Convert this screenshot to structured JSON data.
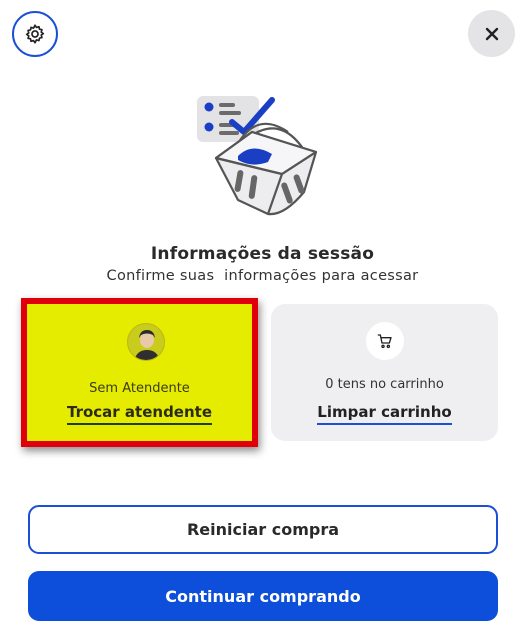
{
  "header": {
    "settings_icon": "gear-icon",
    "close_icon": "close-icon"
  },
  "session": {
    "title": "Informações da sessão",
    "subtitle": "Confirme suas  informações para acessar"
  },
  "attendant_card": {
    "name": "Sem Atendente",
    "action_label": "Trocar atendente",
    "highlight_fill": "#e6ec00",
    "highlight_border": "#e0000a"
  },
  "cart_card": {
    "count_text": "0 tens no carrinho",
    "action_label": "Limpar carrinho",
    "icon": "cart-icon"
  },
  "actions": {
    "restart_label": "Reiniciar compra",
    "continue_label": "Continuar comprando"
  },
  "colors": {
    "accent": "#0d4fdb",
    "close_bg": "#e4e4e6",
    "card_bg": "#efeff1"
  }
}
